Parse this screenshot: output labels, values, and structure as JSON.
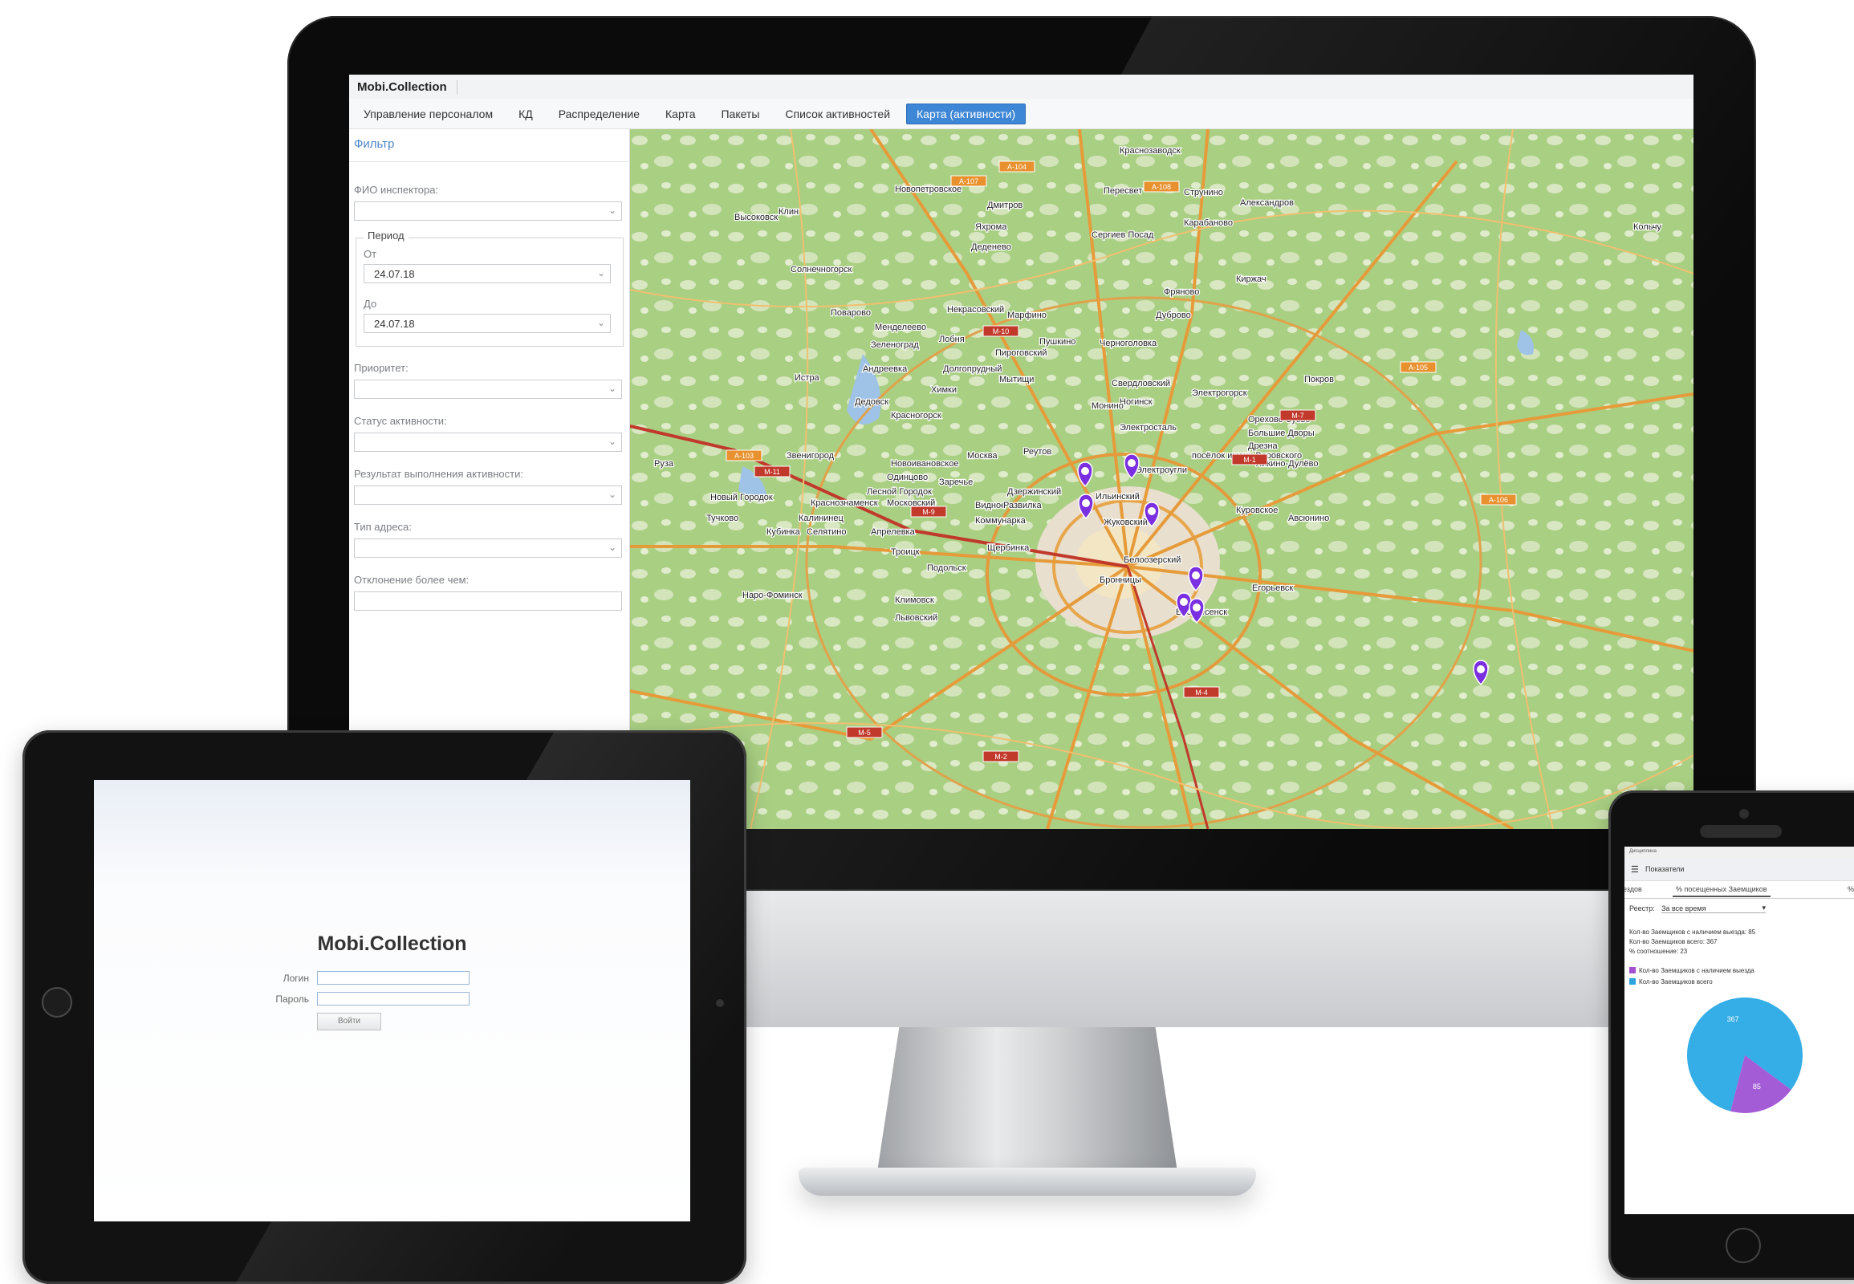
{
  "desktop": {
    "app_title": "Mobi.Collection",
    "tabs": [
      {
        "label": "Управление персоналом",
        "active": false
      },
      {
        "label": "КД",
        "active": false
      },
      {
        "label": "Распределение",
        "active": false
      },
      {
        "label": "Карта",
        "active": false
      },
      {
        "label": "Пакеты",
        "active": false
      },
      {
        "label": "Список активностей",
        "active": false
      },
      {
        "label": "Карта (активности)",
        "active": true
      }
    ],
    "filter": {
      "title": "Фильтр",
      "inspector_label": "ФИО инспектора:",
      "period_legend": "Период",
      "from_label": "От",
      "from_value": "24.07.18",
      "to_label": "До",
      "to_value": "24.07.18",
      "priority_label": "Приоритет:",
      "status_label": "Статус активности:",
      "result_label": "Результат выполнения активности:",
      "address_type_label": "Тип адреса:",
      "deviation_label": "Отклонение более чем:"
    },
    "map": {
      "place_labels": [
        "Красноза­водск",
        "Пересвет",
        "Струнино",
        "Александров",
        "Новопетровское",
        "Дмитров",
        "Высоковск",
        "Клин",
        "Сергиев Посад",
        "Карабаново",
        "Кольчу",
        "Яхрома",
        "Деденево",
        "Солнечногорск",
        "Киржач",
        "Фряново",
        "Поварово",
        "Некрасовский",
        "Марфино",
        "Дуброво",
        "Менделеево",
        "Лобня",
        "Пушкино",
        "Зеленоград",
        "Пироговский",
        "Черноголовка",
        "Андреевка",
        "Долгопрудный",
        "Мытищи",
        "Истра",
        "Свердловский",
        "Покров",
        "Электрогорск",
        "Дедовск",
        "Химки",
        "Ногинск",
        "Монино",
        "Красногорск",
        "Орехово-Зуево",
        "Электросталь",
        "Большие Дворы",
        "Звенигород",
        "Москва",
        "Реутов",
        "посёлок имени Воровского",
        "Дрезна",
        "Новоивановское",
        "Руза",
        "Одинцово",
        "Электроугли",
        "Ликино-Дулёво",
        "Заречье",
        "Лесной Городок",
        "Новый Городок",
        "Краснознаменск",
        "Московский",
        "Дзержинский",
        "Ильинский",
        "Тучково",
        "Калининец",
        "Коммунарка",
        "Видное",
        "Куровское",
        "Авсюнино",
        "Кубинка",
        "Селятино",
        "Апрелевка",
        "Жуковский",
        "Егорьевск",
        "Троицк",
        "Щербинка",
        "Бронницы",
        "Белоозерский",
        "Наро-Фоминск",
        "Подольск",
        "Климовск",
        "Воскресенск",
        "Львовский",
        "Развилка"
      ],
      "road_labels": [
        "А-108",
        "М-11",
        "М-10",
        "М-9",
        "А-107",
        "М-1",
        "М-7",
        "М-4",
        "М-2",
        "М-5",
        "А-103",
        "А-104",
        "А-105",
        "А-106"
      ],
      "markers_count": 8
    }
  },
  "tablet": {
    "title": "Mobi.Collection",
    "login_label": "Логин",
    "password_label": "Пароль",
    "submit_label": "Войти"
  },
  "phone": {
    "status_text": "Дисциплина",
    "appbar_title": "Показатели",
    "tabs": [
      "ездов",
      "% посещенных Заемщиков",
      "% За"
    ],
    "registry_label": "Реестр:",
    "registry_value": "За все время",
    "stats": [
      "Кол-во Заемщиков с наличием выезда: 85",
      "Кол-во Заемщиков всего: 367",
      "% соотношение: 23"
    ],
    "legend": [
      {
        "label": "Кол-во Заемщиков с наличием выезда",
        "color": "#a44fcf"
      },
      {
        "label": "Кол-во Заемщиков всего",
        "color": "#2ea3e0"
      }
    ],
    "chart_data": {
      "type": "pie",
      "categories": [
        "Кол-во Заемщиков всего",
        "Кол-во Заемщиков с наличием выезда"
      ],
      "values": [
        367,
        85
      ],
      "data_labels": [
        "367",
        "85"
      ],
      "colors": [
        "#35ade6",
        "#a45bd6"
      ]
    }
  }
}
